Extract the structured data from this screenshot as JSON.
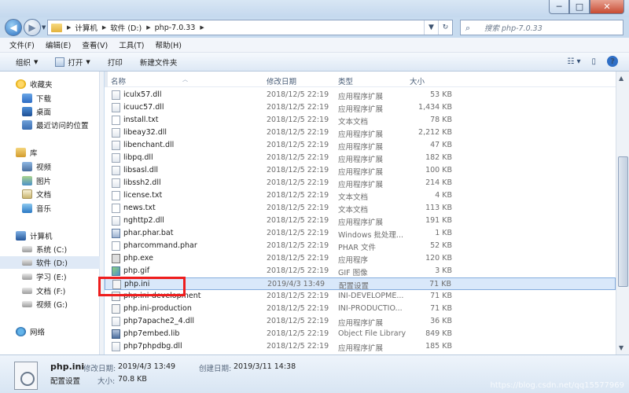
{
  "window": {
    "minimize": "─",
    "maximize": "□",
    "close": "✕"
  },
  "address": {
    "crumbs": [
      "计算机",
      "软件 (D:)",
      "php-7.0.33"
    ]
  },
  "search": {
    "placeholder": "搜索 php-7.0.33"
  },
  "menu": [
    "文件(F)",
    "编辑(E)",
    "查看(V)",
    "工具(T)",
    "帮助(H)"
  ],
  "toolbar": {
    "organize": "组织",
    "open": "打开",
    "print": "打印",
    "new_folder": "新建文件夹"
  },
  "nav": {
    "favorites": "收藏夹",
    "downloads": "下载",
    "desktop": "桌面",
    "recent": "最近访问的位置",
    "library": "库",
    "video": "视频",
    "pictures": "图片",
    "documents": "文档",
    "music": "音乐",
    "computer": "计算机",
    "drive_c": "系统 (C:)",
    "drive_d": "软件 (D:)",
    "drive_e": "学习 (E:)",
    "drive_f": "文档 (F:)",
    "drive_g": "视频 (G:)",
    "network": "网络"
  },
  "columns": {
    "name": "名称",
    "date": "修改日期",
    "type": "类型",
    "size": "大小"
  },
  "files": [
    {
      "name": "iculx57.dll",
      "date": "2018/12/5 22:19",
      "type": "应用程序扩展",
      "size": "53 KB",
      "icon": "dll"
    },
    {
      "name": "icuuc57.dll",
      "date": "2018/12/5 22:19",
      "type": "应用程序扩展",
      "size": "1,434 KB",
      "icon": "dll"
    },
    {
      "name": "install.txt",
      "date": "2018/12/5 22:19",
      "type": "文本文档",
      "size": "78 KB",
      "icon": "txt"
    },
    {
      "name": "libeay32.dll",
      "date": "2018/12/5 22:19",
      "type": "应用程序扩展",
      "size": "2,212 KB",
      "icon": "dll"
    },
    {
      "name": "libenchant.dll",
      "date": "2018/12/5 22:19",
      "type": "应用程序扩展",
      "size": "47 KB",
      "icon": "dll"
    },
    {
      "name": "libpq.dll",
      "date": "2018/12/5 22:19",
      "type": "应用程序扩展",
      "size": "182 KB",
      "icon": "dll"
    },
    {
      "name": "libsasl.dll",
      "date": "2018/12/5 22:19",
      "type": "应用程序扩展",
      "size": "100 KB",
      "icon": "dll"
    },
    {
      "name": "libssh2.dll",
      "date": "2018/12/5 22:19",
      "type": "应用程序扩展",
      "size": "214 KB",
      "icon": "dll"
    },
    {
      "name": "license.txt",
      "date": "2018/12/5 22:19",
      "type": "文本文档",
      "size": "4 KB",
      "icon": "txt"
    },
    {
      "name": "news.txt",
      "date": "2018/12/5 22:19",
      "type": "文本文档",
      "size": "113 KB",
      "icon": "txt"
    },
    {
      "name": "nghttp2.dll",
      "date": "2018/12/5 22:19",
      "type": "应用程序扩展",
      "size": "191 KB",
      "icon": "dll"
    },
    {
      "name": "phar.phar.bat",
      "date": "2018/12/5 22:19",
      "type": "Windows 批处理...",
      "size": "1 KB",
      "icon": "bat"
    },
    {
      "name": "pharcommand.phar",
      "date": "2018/12/5 22:19",
      "type": "PHAR 文件",
      "size": "52 KB",
      "icon": "phar"
    },
    {
      "name": "php.exe",
      "date": "2018/12/5 22:19",
      "type": "应用程序",
      "size": "120 KB",
      "icon": "exe"
    },
    {
      "name": "php.gif",
      "date": "2018/12/5 22:19",
      "type": "GIF 图像",
      "size": "3 KB",
      "icon": "gif"
    },
    {
      "name": "php.ini",
      "date": "2019/4/3 13:49",
      "type": "配置设置",
      "size": "71 KB",
      "icon": "ini",
      "selected": true
    },
    {
      "name": "php.ini-development",
      "date": "2018/12/5 22:19",
      "type": "INI-DEVELOPME...",
      "size": "71 KB",
      "icon": "ini"
    },
    {
      "name": "php.ini-production",
      "date": "2018/12/5 22:19",
      "type": "INI-PRODUCTIO...",
      "size": "71 KB",
      "icon": "ini"
    },
    {
      "name": "php7apache2_4.dll",
      "date": "2018/12/5 22:19",
      "type": "应用程序扩展",
      "size": "36 KB",
      "icon": "dll"
    },
    {
      "name": "php7embed.lib",
      "date": "2018/12/5 22:19",
      "type": "Object File Library",
      "size": "849 KB",
      "icon": "lib"
    },
    {
      "name": "php7phpdbg.dll",
      "date": "2018/12/5 22:19",
      "type": "应用程序扩展",
      "size": "185 KB",
      "icon": "dll"
    }
  ],
  "details": {
    "filename": "php.ini",
    "filetype": "配置设置",
    "modified_label": "修改日期:",
    "modified_value": "2019/4/3 13:49",
    "created_label": "创建日期:",
    "created_value": "2019/3/11 14:38",
    "size_label": "大小:",
    "size_value": "70.8 KB"
  },
  "watermark": "https://blog.csdn.net/qq15577969"
}
